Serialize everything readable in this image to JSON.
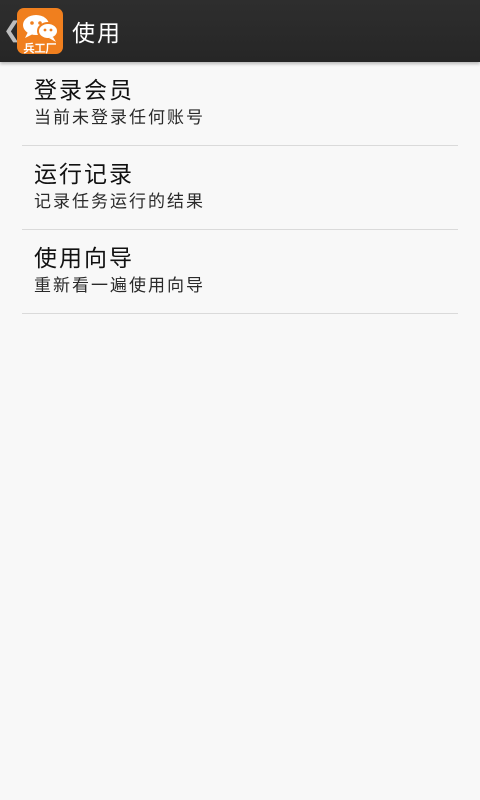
{
  "action_bar": {
    "title": "使用",
    "back_glyph": "❮",
    "logo_text": "兵工厂",
    "logo_icon": "chat-bubbles-icon",
    "accent_color": "#f07f1e"
  },
  "menu": {
    "items": [
      {
        "title": "登录会员",
        "subtitle": "当前未登录任何账号"
      },
      {
        "title": "运行记录",
        "subtitle": "记录任务运行的结果"
      },
      {
        "title": "使用向导",
        "subtitle": "重新看一遍使用向导"
      }
    ]
  }
}
